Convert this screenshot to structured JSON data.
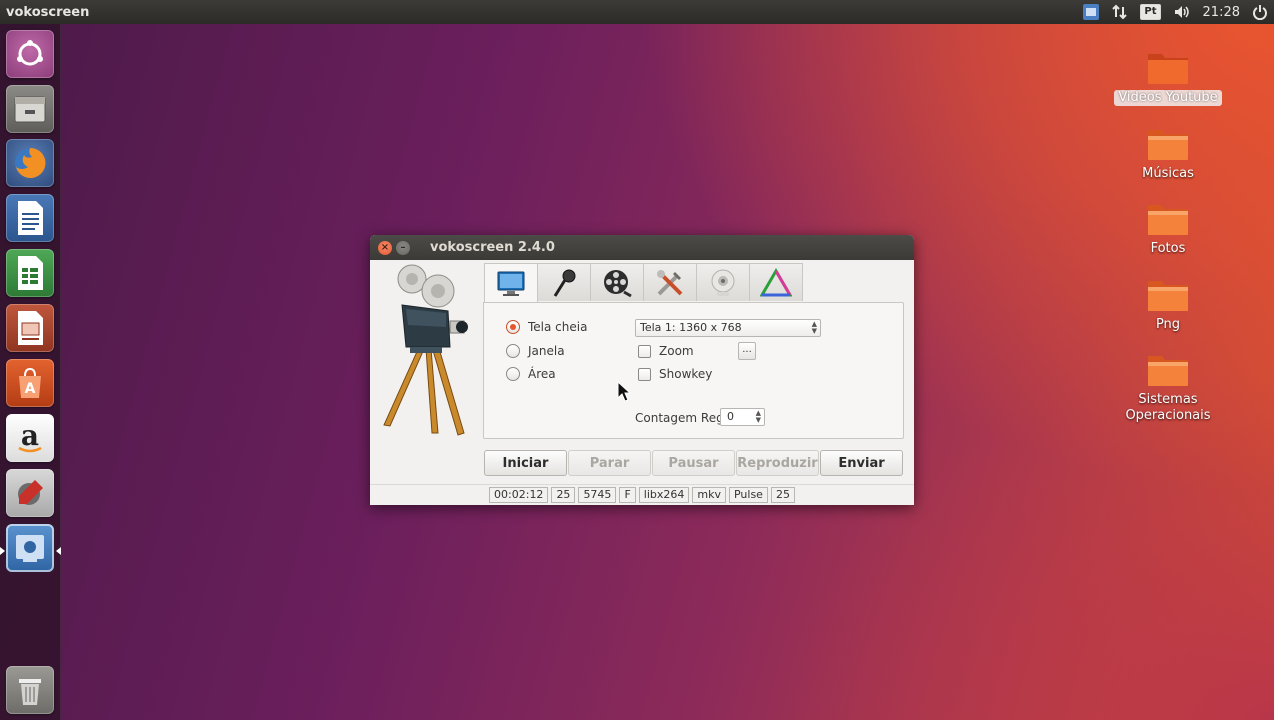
{
  "top_panel": {
    "app_title": "vokoscreen",
    "keyboard_layout": "Pt",
    "clock": "21:28"
  },
  "launcher": {
    "items": [
      "ubuntu-dash",
      "files",
      "firefox",
      "libreoffice-writer",
      "libreoffice-calc",
      "libreoffice-impress",
      "ubuntu-software",
      "amazon",
      "system-settings",
      "vokoscreen"
    ],
    "trash": "trash"
  },
  "desktop": {
    "icons": [
      {
        "label": "Videos Youtube",
        "selected": true
      },
      {
        "label": "Músicas"
      },
      {
        "label": "Fotos"
      },
      {
        "label": "Png"
      },
      {
        "label": "Sistemas Operacionais"
      }
    ]
  },
  "window": {
    "title": "vokoscreen 2.4.0",
    "tabs": [
      "screen-tab",
      "microphone-tab",
      "video-tab",
      "settings-tab",
      "webcam-tab",
      "about-tab"
    ],
    "capture": {
      "fullscreen_label": "Tela cheia",
      "window_label": "Janela",
      "area_label": "Área",
      "selected": "fullscreen",
      "screen_select_value": "Tela 1:  1360 x 768",
      "zoom_label": "Zoom",
      "zoom_more_label": "...",
      "showkey_label": "Showkey",
      "countdown_label": "Contagem Reg",
      "countdown_value": "0"
    },
    "buttons": {
      "start": "Iniciar",
      "stop": "Parar",
      "pause": "Pausar",
      "play": "Reproduzir",
      "send": "Enviar"
    },
    "status": [
      "00:02:12",
      "25",
      "5745",
      "F",
      "libx264",
      "mkv",
      "Pulse",
      "25"
    ]
  },
  "colors": {
    "accent": "#e4572e",
    "panel": "#3c3b37",
    "folder": "#f06a2d"
  }
}
